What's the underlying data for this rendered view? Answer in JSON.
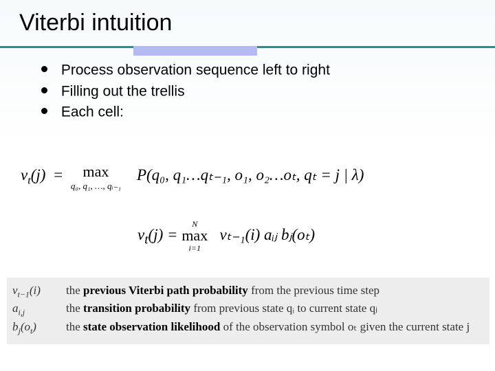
{
  "title": "Viterbi intuition",
  "bullets": [
    "Process observation sequence left to right",
    "Filling out the trellis",
    "Each cell:"
  ],
  "formula1": {
    "lhs_v": "v",
    "lhs_t": "t",
    "lhs_j": "j",
    "max_op": "max",
    "max_sub": "q₀, q₁, …, qᵢ₋₁",
    "rhs": "P(q₀, q₁…qₜ₋₁, o₁, o₂…oₜ, qₜ = j | λ)"
  },
  "formula2": {
    "lhs_v": "v",
    "lhs_t": "t",
    "lhs_j": "j",
    "N": "N",
    "max_op": "max",
    "max_sub": "i=1",
    "rhs": "vₜ₋₁(i) aᵢⱼ bⱼ(oₜ)"
  },
  "definitions": [
    {
      "sym_html": "v<sub>t−1</sub>(i)",
      "lead": "the ",
      "bold": "previous Viterbi path probability",
      "tail": " from the previous time step"
    },
    {
      "sym_html": "a<sub>i,j</sub>",
      "lead": "the ",
      "bold": "transition probability",
      "tail": " from previous state qᵢ to current state qⱼ"
    },
    {
      "sym_html": "b<sub>j</sub>(o<sub>t</sub>)",
      "lead": "the ",
      "bold": "state observation likelihood",
      "tail": " of the observation symbol oₜ given the current state j"
    }
  ]
}
